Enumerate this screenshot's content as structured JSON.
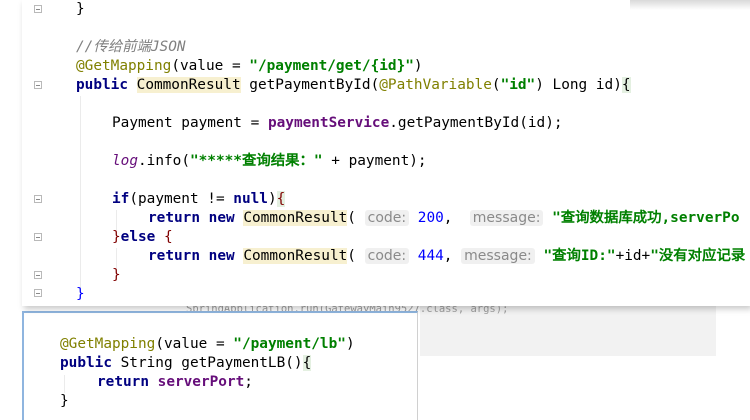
{
  "background": {
    "code_fragment": "SpringApplication.run(GatewayMain9527.class, args);"
  },
  "main_editor": {
    "lines": {
      "close_brace_top": "}",
      "comment": "//传给前端JSON",
      "get_mapping_annotation": "@GetMapping",
      "get_mapping_args_open": "(value = ",
      "get_mapping_path": "\"/payment/get/{id}\"",
      "get_mapping_args_close": ")",
      "kw_public": "public",
      "return_type": "CommonResult",
      "method_name": " getPaymentById(",
      "path_variable": "@PathVariable",
      "pv_open": "(",
      "pv_value": "\"id\"",
      "pv_close_params": ") Long id)",
      "method_open_brace": "{",
      "payment_decl": "Payment payment = ",
      "service_field": "paymentService",
      "service_call": ".getPaymentById(id);",
      "log_name": "log",
      "log_call_open": ".info(",
      "log_string": "\"*****查询结果：\"",
      "log_call_rest": " + payment);",
      "kw_if": "if",
      "if_cond_open": "(payment != ",
      "kw_null": "null",
      "if_cond_close": ")",
      "if_open_brace": "{",
      "kw_return": "return",
      "kw_new": "new",
      "result_class": "CommonResult",
      "paren_open": "(",
      "hint_code": "code:",
      "code_success": "200",
      "comma": ",",
      "hint_message": "message:",
      "success_message": "\"查询数据库成功,serverPo",
      "else_close_brace": "}",
      "kw_else": "else",
      "else_open_brace": "{",
      "code_fail": "444",
      "fail_message_part1": "\"查询ID:\"",
      "fail_message_concat": "+id+",
      "fail_message_part2": "\"没有对应记录",
      "if_close_brace": "}",
      "method_close_brace": "}"
    }
  },
  "bottom_editor": {
    "lines": {
      "get_mapping_annotation": "@GetMapping",
      "get_mapping_args_open": "(value = ",
      "get_mapping_path": "\"/payment/lb\"",
      "get_mapping_args_close": ")",
      "kw_public": "public",
      "signature": " String getPaymentLB()",
      "open_brace": "{",
      "kw_return": "return",
      "field_server_port": "serverPort",
      "semicolon": ";",
      "close_brace": "}"
    }
  },
  "colors": {
    "keyword": "#000080",
    "annotation": "#808000",
    "string": "#008000",
    "comment": "#808080",
    "field": "#660e7a",
    "number": "#0000ff",
    "panel_border_accent": "#8fb5df"
  }
}
